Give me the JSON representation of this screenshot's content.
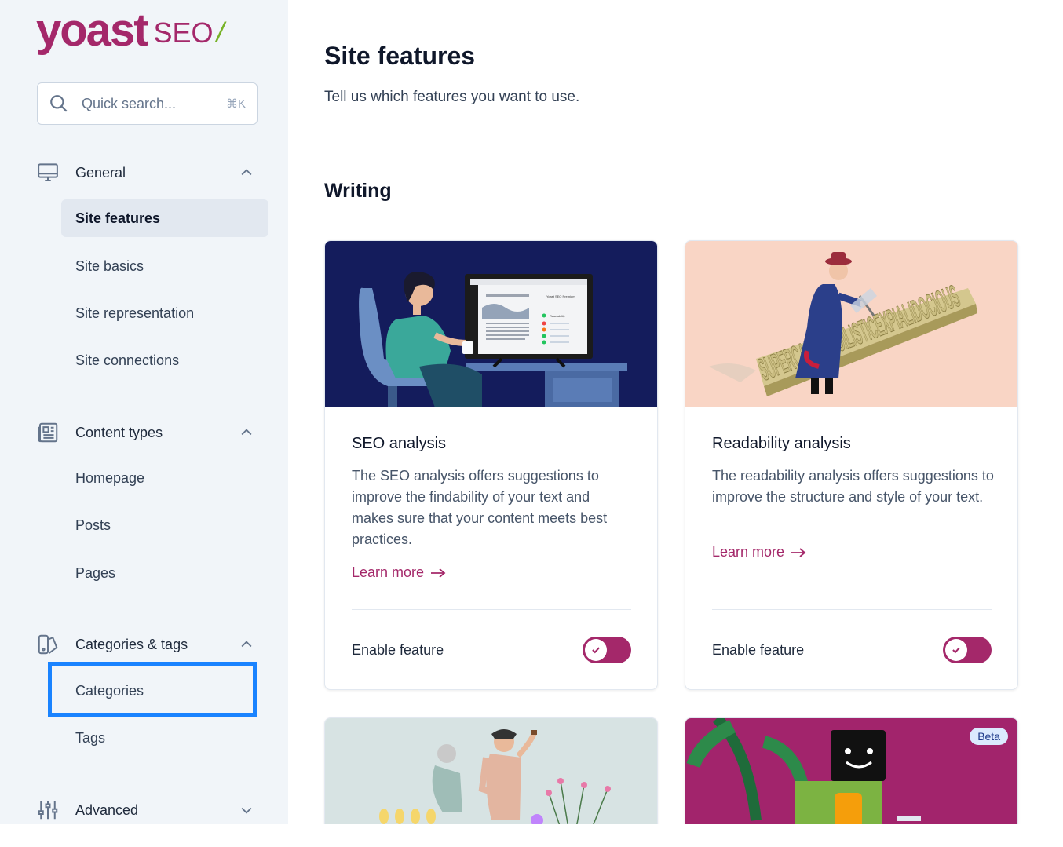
{
  "brand": {
    "logo_main": "yoast",
    "logo_seo": "SEO",
    "logo_slash": "/"
  },
  "search": {
    "placeholder": "Quick search...",
    "shortcut": "⌘K"
  },
  "sidebar": {
    "groups": [
      {
        "label": "General",
        "icon": "monitor-icon",
        "expanded": true,
        "items": [
          "Site features",
          "Site basics",
          "Site representation",
          "Site connections"
        ]
      },
      {
        "label": "Content types",
        "icon": "newspaper-icon",
        "expanded": true,
        "items": [
          "Homepage",
          "Posts",
          "Pages"
        ]
      },
      {
        "label": "Categories & tags",
        "icon": "tag-icon",
        "expanded": true,
        "items": [
          "Categories",
          "Tags"
        ]
      },
      {
        "label": "Advanced",
        "icon": "sliders-icon",
        "expanded": false,
        "items": []
      }
    ],
    "active_item": "Site features",
    "highlighted_item": "Categories"
  },
  "page": {
    "title": "Site features",
    "subtitle": "Tell us which features you want to use.",
    "section": "Writing"
  },
  "cards": [
    {
      "title": "SEO analysis",
      "description": "The SEO analysis offers suggestions to improve the findability of your text and makes sure that your content meets best practices.",
      "learn_more": "Learn more",
      "enable_label": "Enable feature",
      "enabled": true
    },
    {
      "title": "Readability analysis",
      "description": "The readability analysis offers suggestions to improve the structure and style of your text.",
      "learn_more": "Learn more",
      "enable_label": "Enable feature",
      "enabled": true
    },
    {
      "badge": ""
    },
    {
      "badge": "Beta"
    }
  ],
  "illustration_text": {
    "word": "SUPERCALIFRAGILISTICEXPIALIDOCIOUS",
    "screen_header": "Yoast SEO Premium",
    "screen_label": "Readability"
  },
  "colors": {
    "brand": "#a4286a",
    "accent": "#77b227",
    "highlight": "#1a83ff"
  }
}
